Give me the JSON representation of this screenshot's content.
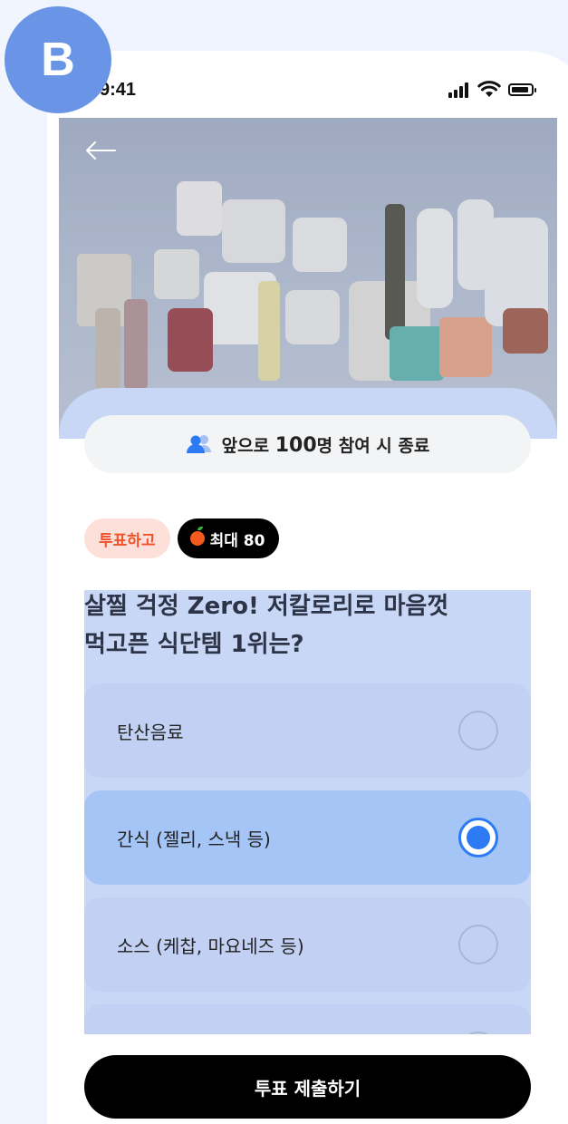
{
  "badge": {
    "letter": "B"
  },
  "status_bar": {
    "time": "9:41"
  },
  "participants": {
    "prefix": "앞으로",
    "count": "100",
    "suffix": "명 참여 시 종료"
  },
  "tags": {
    "vote": "투표하고",
    "max_reward": "최대 80"
  },
  "question": {
    "line1": "살찔 걱정 Zero! 저칼로리로 마음껏",
    "line2": "먹고픈 식단템 1위는?"
  },
  "options": [
    {
      "label": "탄산음료",
      "selected": false
    },
    {
      "label": "간식 (젤리, 스낵 등)",
      "selected": true
    },
    {
      "label": "소스 (케찹, 마요네즈 등)",
      "selected": false
    }
  ],
  "submit": {
    "label": "투표 제출하기"
  },
  "colors": {
    "accent": "#2d7bf2",
    "badge": "#6a95e6",
    "tag_vote_text": "#f0532a",
    "tag_vote_bg": "#fde0da"
  },
  "icons": {
    "back": "arrow-left-icon",
    "people": "people-icon",
    "apple": "apple-icon"
  }
}
